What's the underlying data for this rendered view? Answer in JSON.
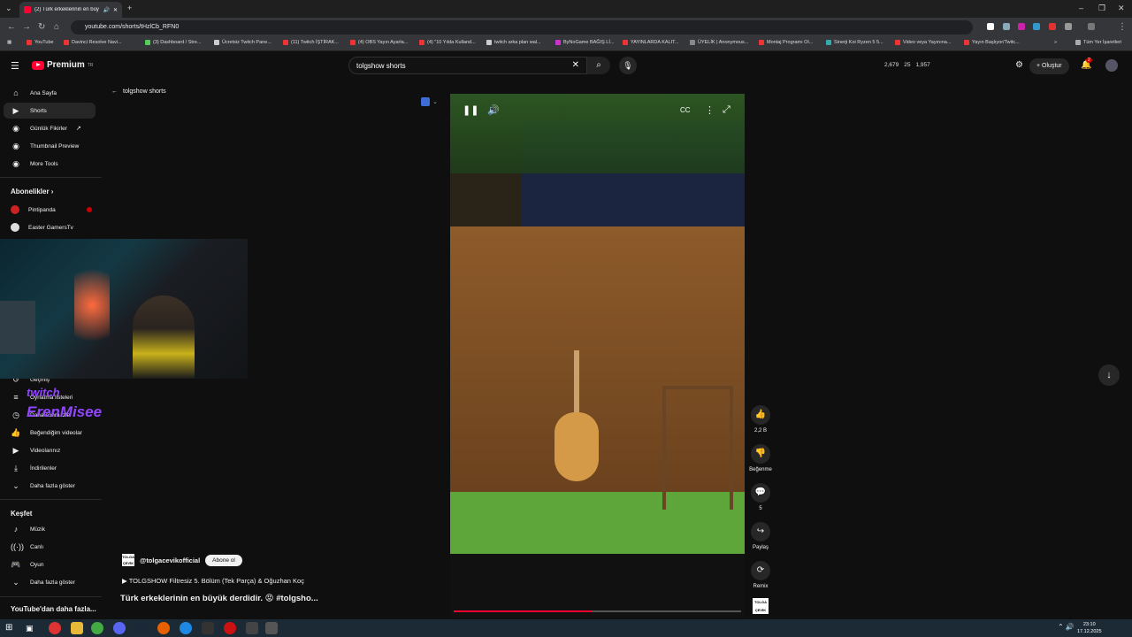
{
  "browser": {
    "tab_title": "(2) Türk erkeklerinin en büy...",
    "url": "youtube.com/shorts/tHzlCb_RFN0",
    "bookmarks": [
      "YouTube",
      "Davinci Resolve Navi...",
      "(3) Dashboard / Stre...",
      "Ücretsiz Twitch Pane...",
      "(11) Twitch İŞTİRAK...",
      "(4) OBS Yayın Ayarla...",
      "(4) \"10 Yılda Kulland...",
      "twitch arka plan wal...",
      "ByNoGame BAĞIŞ Lİ...",
      "YAYINLARDA KALIT...",
      "ÜYELİK | Anonymous...",
      "Montaj Programı Ol...",
      "Sinerji Koi Ryzen 5 5...",
      "Video veya Yayınına...",
      "Yayın Başlıyor/Twitc..."
    ],
    "all_bookmarks": "Tüm Yer İşaretleri"
  },
  "header": {
    "logo_text": "Premium",
    "logo_sup": "TR",
    "search_value": "tolgshow shorts",
    "stats": [
      "2,679",
      "25",
      "1,957"
    ],
    "create_label": "Oluştur",
    "notif_count": "2"
  },
  "sidebar": {
    "top_items": [
      {
        "label": "Ana Sayfa",
        "icon": "home-icon"
      },
      {
        "label": "Shorts",
        "icon": "shorts-icon"
      },
      {
        "label": "Günlük Fikirler",
        "icon": "bulb-icon"
      },
      {
        "label": "Thumbnail Preview",
        "icon": "image-icon"
      },
      {
        "label": "More Tools",
        "icon": "tools-icon"
      }
    ],
    "subs_header": "Abonelikler",
    "subs": [
      {
        "label": "Pintipanda",
        "icon": "avatar-icon"
      },
      {
        "label": "Easter GamersTv",
        "icon": "avatar-icon"
      }
    ],
    "you_items": [
      {
        "label": "Geçmiş",
        "icon": "history-icon"
      },
      {
        "label": "Oynatma listeleri",
        "icon": "playlist-icon"
      },
      {
        "label": "Daha sonra izle",
        "icon": "clock-icon"
      },
      {
        "label": "Beğendiğim videolar",
        "icon": "like-icon"
      },
      {
        "label": "Videolarınız",
        "icon": "video-icon"
      },
      {
        "label": "İndirilenler",
        "icon": "download-icon"
      },
      {
        "label": "Daha fazla göster",
        "icon": "chevron-down-icon"
      }
    ],
    "explore_header": "Keşfet",
    "explore": [
      {
        "label": "Müzik",
        "icon": "music-icon"
      },
      {
        "label": "Canlı",
        "icon": "live-icon"
      },
      {
        "label": "Oyun",
        "icon": "game-icon"
      },
      {
        "label": "Daha fazla göster",
        "icon": "chevron-down-icon"
      }
    ],
    "more_header": "YouTube'dan daha fazla..."
  },
  "overlay": {
    "twitch_text": "twitch",
    "twitch_name": "ErenMisee"
  },
  "breadcrumb": "tolgshow shorts",
  "video": {
    "progress": 0.48
  },
  "actions": [
    {
      "label": "2,2 B",
      "icon": "thumb-up-icon"
    },
    {
      "label": "Beğenme",
      "icon": "thumb-down-icon"
    },
    {
      "label": "5",
      "icon": "comment-icon"
    },
    {
      "label": "Paylaş",
      "icon": "share-icon"
    },
    {
      "label": "Remix",
      "icon": "remix-icon"
    }
  ],
  "channel": {
    "handle": "@tolgacevikofficial",
    "subscribe_label": "Abone ol",
    "logo_text": "TOLGA ÇEVİK"
  },
  "playlist_text": "TOLGSHOW Filtresiz 5. Bölüm (Tek Parça) & Oğuzhan Koç",
  "video_title": "Türk erkeklerinin en büyük derdidir. 😡 #tolgsho...",
  "clock": {
    "time": "23:10",
    "date": "17.12.2025"
  }
}
